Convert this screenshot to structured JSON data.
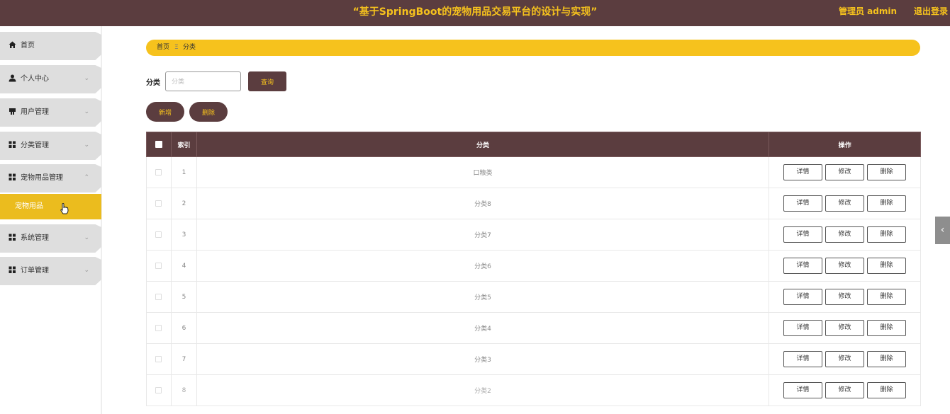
{
  "header": {
    "title": "“基于SpringBoot的宠物用品交易平台的设计与实现”",
    "user": "管理员 admin",
    "logout": "退出登录"
  },
  "sidebar": {
    "items": [
      {
        "label": "首页",
        "icon": "home-icon",
        "arrow": ""
      },
      {
        "label": "个人中心",
        "icon": "user-icon",
        "arrow": "⌄"
      },
      {
        "label": "用户管理",
        "icon": "users-icon",
        "arrow": "⌄"
      },
      {
        "label": "分类管理",
        "icon": "grid-icon",
        "arrow": "⌄"
      },
      {
        "label": "宠物用品管理",
        "icon": "grid-icon",
        "arrow": "⌃"
      },
      {
        "label": "系统管理",
        "icon": "grid-icon",
        "arrow": "⌄"
      },
      {
        "label": "订单管理",
        "icon": "grid-icon",
        "arrow": "⌄"
      }
    ],
    "active_subitem": "宠物用品"
  },
  "breadcrumb": {
    "home": "首页",
    "separator": "Ξ",
    "current": "分类"
  },
  "search": {
    "label": "分类",
    "placeholder": "分类",
    "value": "",
    "query_button": "查询"
  },
  "actions": {
    "add": "新增",
    "delete": "删除"
  },
  "table": {
    "headers": [
      "",
      "索引",
      "分类",
      "操作"
    ],
    "rows": [
      {
        "index": "1",
        "name": "口粮类"
      },
      {
        "index": "2",
        "name": "分类8"
      },
      {
        "index": "3",
        "name": "分类7"
      },
      {
        "index": "4",
        "name": "分类6"
      },
      {
        "index": "5",
        "name": "分类5"
      },
      {
        "index": "6",
        "name": "分类4"
      },
      {
        "index": "7",
        "name": "分类3"
      },
      {
        "index": "8",
        "name": "分类2"
      }
    ],
    "op_labels": {
      "detail": "详情",
      "edit": "修改",
      "delete": "删除"
    }
  },
  "side_toggle": "‹",
  "colors": {
    "primary": "#5b3d3f",
    "accent": "#f6c21d",
    "active_menu": "#ebbc1e"
  }
}
